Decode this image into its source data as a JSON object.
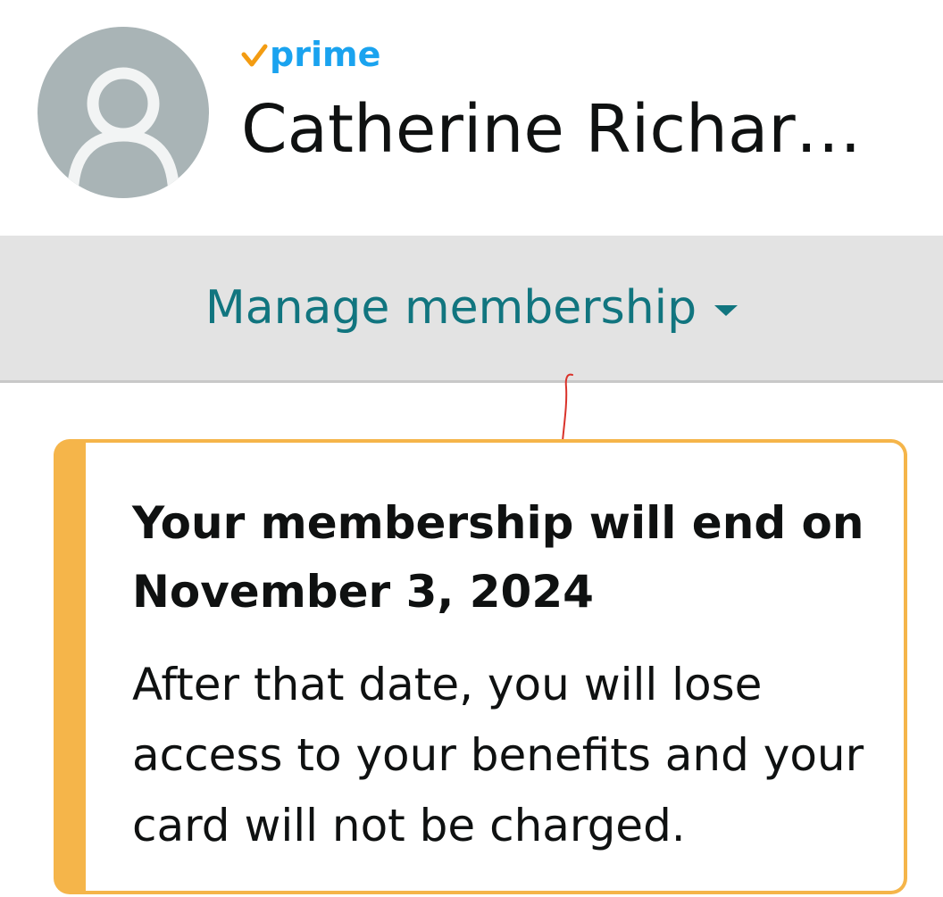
{
  "profile": {
    "badge": "prime",
    "name": "Catherine Richar…"
  },
  "membership": {
    "manage_label": "Manage membership"
  },
  "notice": {
    "title": "Your membership will end on November 3, 2024",
    "body": "After that date, you will lose access to your benefits and your card will not be charged."
  },
  "colors": {
    "prime_blue": "#1aa3ef",
    "prime_check": "#f39c12",
    "link_teal": "#11757f",
    "alert_border": "#f5b54a",
    "avatar_bg": "#a9b4b6",
    "bar_bg": "#e3e3e3",
    "annotation_red": "#d9332b"
  },
  "icons": {
    "avatar": "user-silhouette-icon",
    "prime_check": "check-icon",
    "dropdown": "caret-down-icon"
  }
}
